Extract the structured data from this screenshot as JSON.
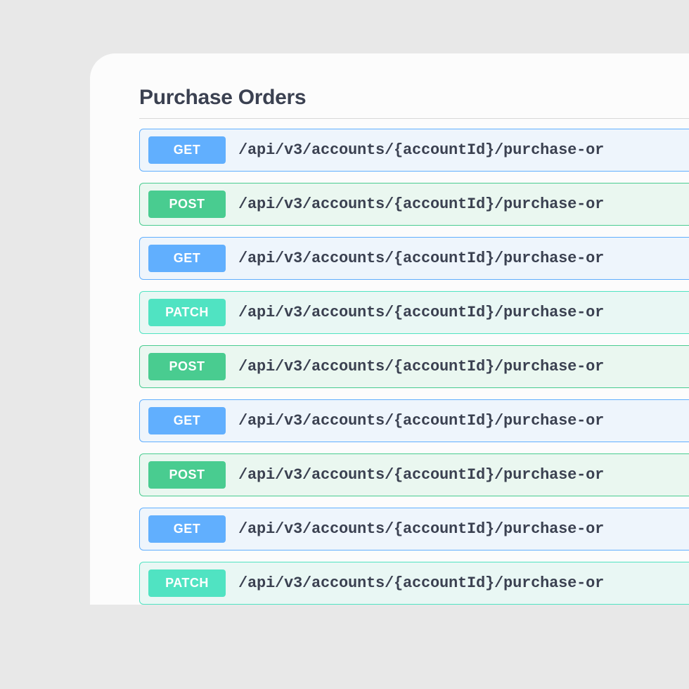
{
  "section": {
    "title": "Purchase Orders"
  },
  "endpoints": [
    {
      "method": "GET",
      "path": "/api/v3/accounts/{accountId}/purchase-or"
    },
    {
      "method": "POST",
      "path": "/api/v3/accounts/{accountId}/purchase-or"
    },
    {
      "method": "GET",
      "path": "/api/v3/accounts/{accountId}/purchase-or"
    },
    {
      "method": "PATCH",
      "path": "/api/v3/accounts/{accountId}/purchase-or"
    },
    {
      "method": "POST",
      "path": "/api/v3/accounts/{accountId}/purchase-or"
    },
    {
      "method": "GET",
      "path": "/api/v3/accounts/{accountId}/purchase-or"
    },
    {
      "method": "POST",
      "path": "/api/v3/accounts/{accountId}/purchase-or"
    },
    {
      "method": "GET",
      "path": "/api/v3/accounts/{accountId}/purchase-or"
    },
    {
      "method": "PATCH",
      "path": "/api/v3/accounts/{accountId}/purchase-or"
    }
  ]
}
